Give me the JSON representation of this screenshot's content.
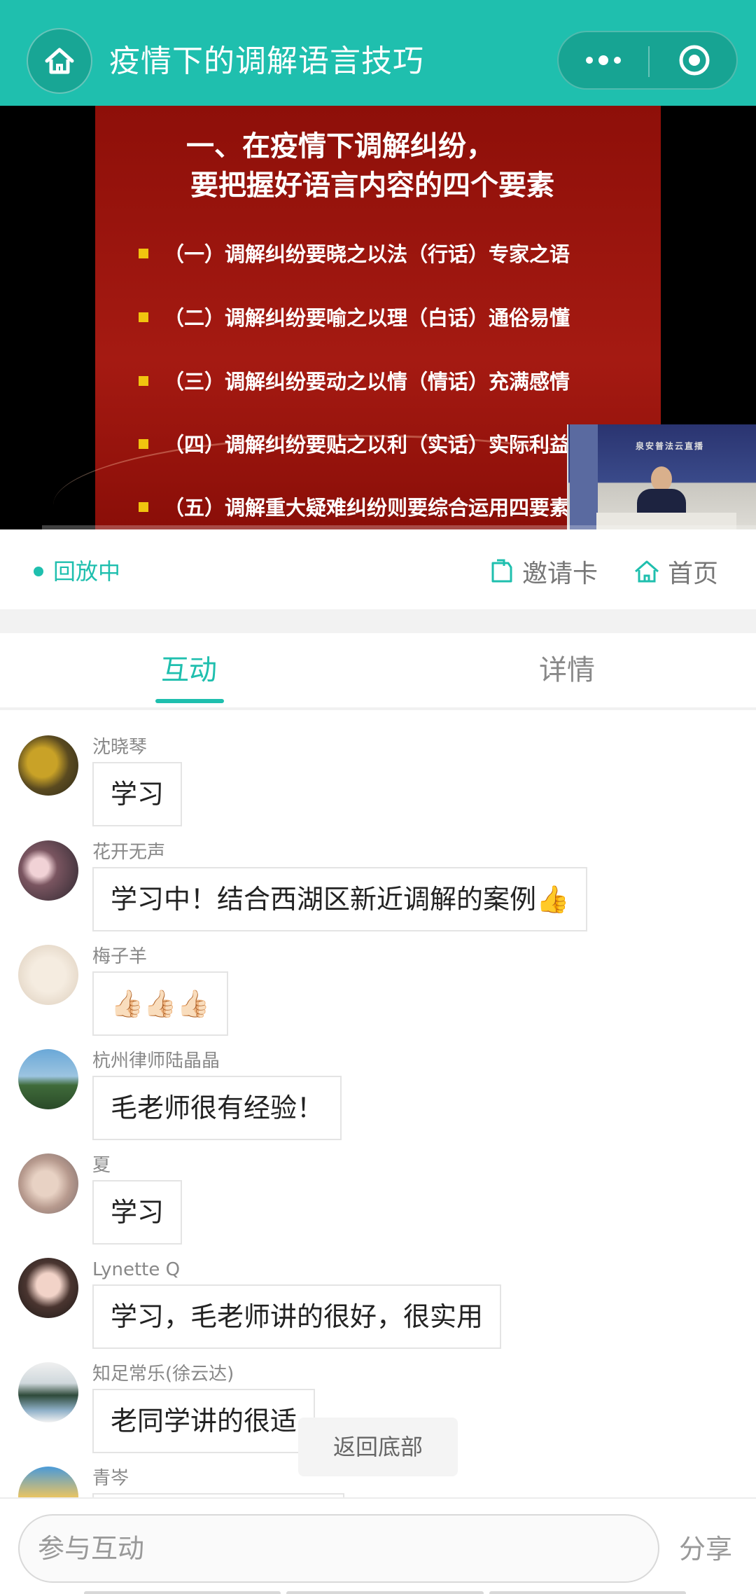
{
  "header": {
    "title": "疫情下的调解语言技巧",
    "accent_color": "#1fbfae"
  },
  "video": {
    "slide_title_line1": "一、在疫情下调解纠纷，",
    "slide_title_line2": "要把握好语言内容的四个要素",
    "bullets": [
      "（一）调解纠纷要晓之以法（行话）专家之语",
      "（二）调解纠纷要喻之以理（白话）通俗易懂",
      "（三）调解纠纷要动之以情（情话）充满感情",
      "（四）调解纠纷要贴之以利（实话）实际利益",
      "（五）调解重大疑难纠纷则要综合运用四要素"
    ],
    "pip_caption": "泉安普法云直播"
  },
  "status": {
    "playback_label": "回放中",
    "invite_label": "邀请卡",
    "home_label": "首页"
  },
  "tabs": {
    "interact": "互动",
    "details": "详情"
  },
  "messages": [
    {
      "user": "沈晓琴",
      "text": "学习"
    },
    {
      "user": "花开无声",
      "text": "学习中！结合西湖区新近调解的案例👍"
    },
    {
      "user": "梅子羊",
      "text": "👍🏻👍🏻👍🏻"
    },
    {
      "user": "杭州律师陆晶晶",
      "text": "毛老师很有经验！"
    },
    {
      "user": "夏",
      "text": "学习"
    },
    {
      "user": "Lynette Q",
      "text": "学习，毛老师讲的很好，很实用"
    },
    {
      "user": "知足常乐(徐云达)",
      "text": "老同学讲的很适"
    },
    {
      "user": "青岑",
      "text": ""
    }
  ],
  "back_to_bottom": "返回底部",
  "input": {
    "placeholder": "参与互动",
    "share_label": "分享"
  }
}
